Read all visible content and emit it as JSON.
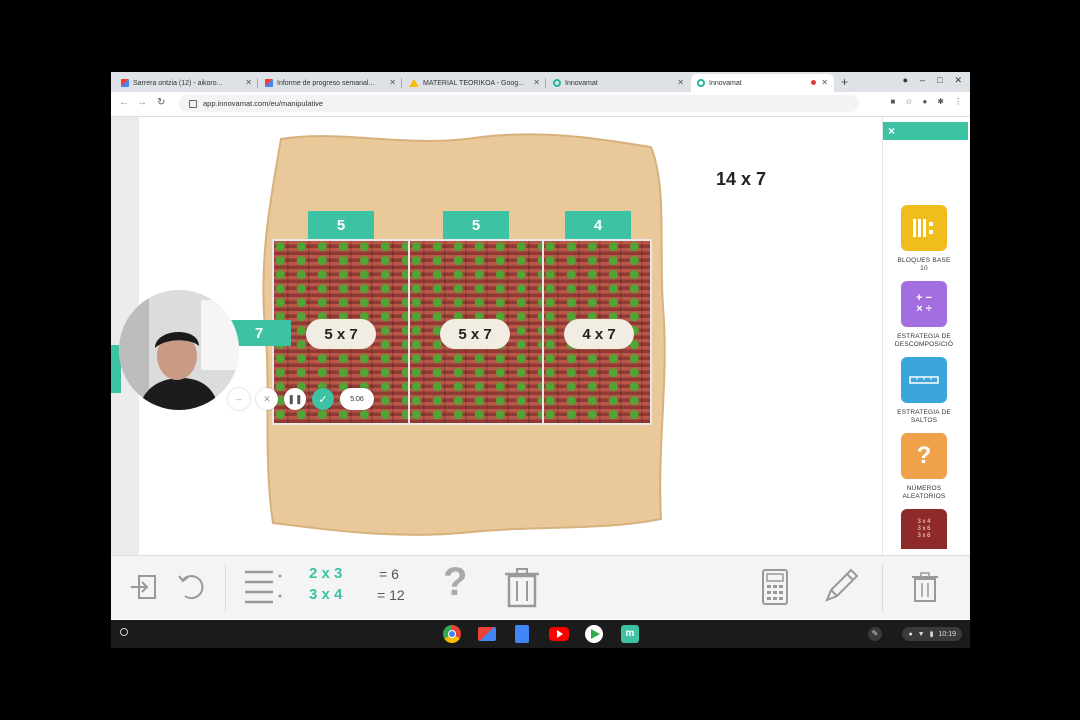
{
  "browser": {
    "tabs": [
      {
        "title": "Sarrera ontzia (12) - aikoro...",
        "icon": "gmail-icon"
      },
      {
        "title": "Informe de progreso semanal...",
        "icon": "gmail-icon"
      },
      {
        "title": "MATERIAL TEORIKOA - Goog...",
        "icon": "drive-icon"
      },
      {
        "title": "Innovamat",
        "icon": "innovamat-icon"
      },
      {
        "title": "Innovamat",
        "icon": "innovamat-icon"
      }
    ],
    "new_tab": "+",
    "url": "app.innovamat.com/eu/manipulative"
  },
  "problem": {
    "title": "14 x 7"
  },
  "columns": [
    {
      "width_label": "5",
      "product": "5 x 7"
    },
    {
      "width_label": "5",
      "product": "5 x 7"
    },
    {
      "width_label": "4",
      "product": "4 x 7"
    }
  ],
  "row_label": "7",
  "sidebar": {
    "close": "×",
    "tools": [
      {
        "label": "BLOQUES BASE\n10",
        "color": "#f0bd1c",
        "icon": "base-ten-blocks-icon"
      },
      {
        "label": "ESTRATEGIA DE\nDESCOMPOSICIÓ",
        "color": "#a36ee0",
        "icon": "math-operations-icon"
      },
      {
        "label": "ESTRATEGIA DE\nSALTOS",
        "color": "#3aa6d9",
        "icon": "number-line-icon"
      },
      {
        "label": "NÚMEROS\nALEATORIOS",
        "color": "#f0a24a",
        "icon": "question-mark-icon"
      },
      {
        "label": "",
        "color": "#8e2a2a",
        "icon": "multiplication-table-icon",
        "tile_text": "3 x 4\n3 x 6\n3 x 6"
      }
    ]
  },
  "bottom": {
    "equations": [
      {
        "expr": "2 x 3",
        "result": "= 6"
      },
      {
        "expr": "3 x 4",
        "result": "= 12"
      }
    ],
    "help": "?"
  },
  "recorder": {
    "timer": "5:06"
  },
  "shelf": {
    "time": "10:19"
  }
}
